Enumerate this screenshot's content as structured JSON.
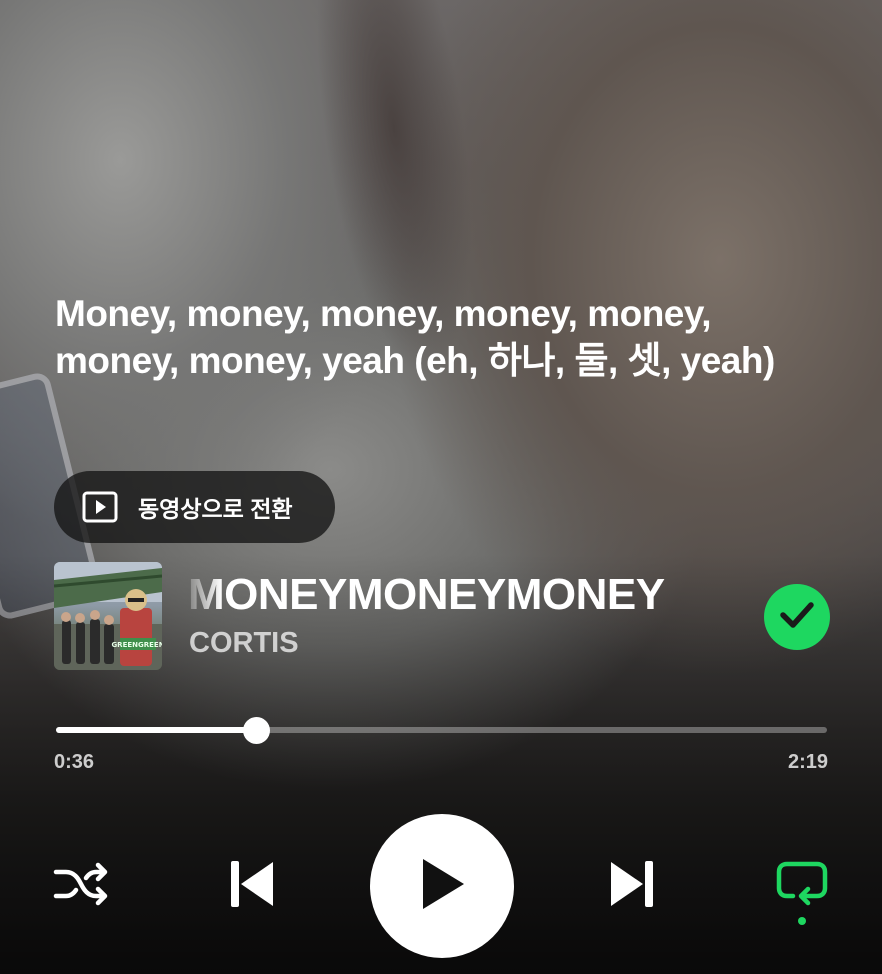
{
  "lyrics": {
    "line1": "Money, money, money, money, money,",
    "line2": "money, money, yeah (eh, 하나, 둘, 셋, yeah)"
  },
  "video_toggle": {
    "label": "동영상으로 전환",
    "icon": "video-play-icon"
  },
  "track": {
    "title": "MONEYMONEYMONEY",
    "artist": "CORTIS",
    "album_art_text": "GREENGREEN",
    "liked": true
  },
  "playback": {
    "elapsed": "0:36",
    "duration": "2:19",
    "progress_fraction": 0.26,
    "is_playing": false
  },
  "controls": {
    "shuffle_icon": "shuffle-icon",
    "previous_icon": "skip-previous-icon",
    "play_icon": "play-icon",
    "next_icon": "skip-next-icon",
    "repeat_icon": "repeat-icon",
    "repeat_active": true
  },
  "colors": {
    "accent": "#1ed760",
    "text": "#ffffff"
  }
}
